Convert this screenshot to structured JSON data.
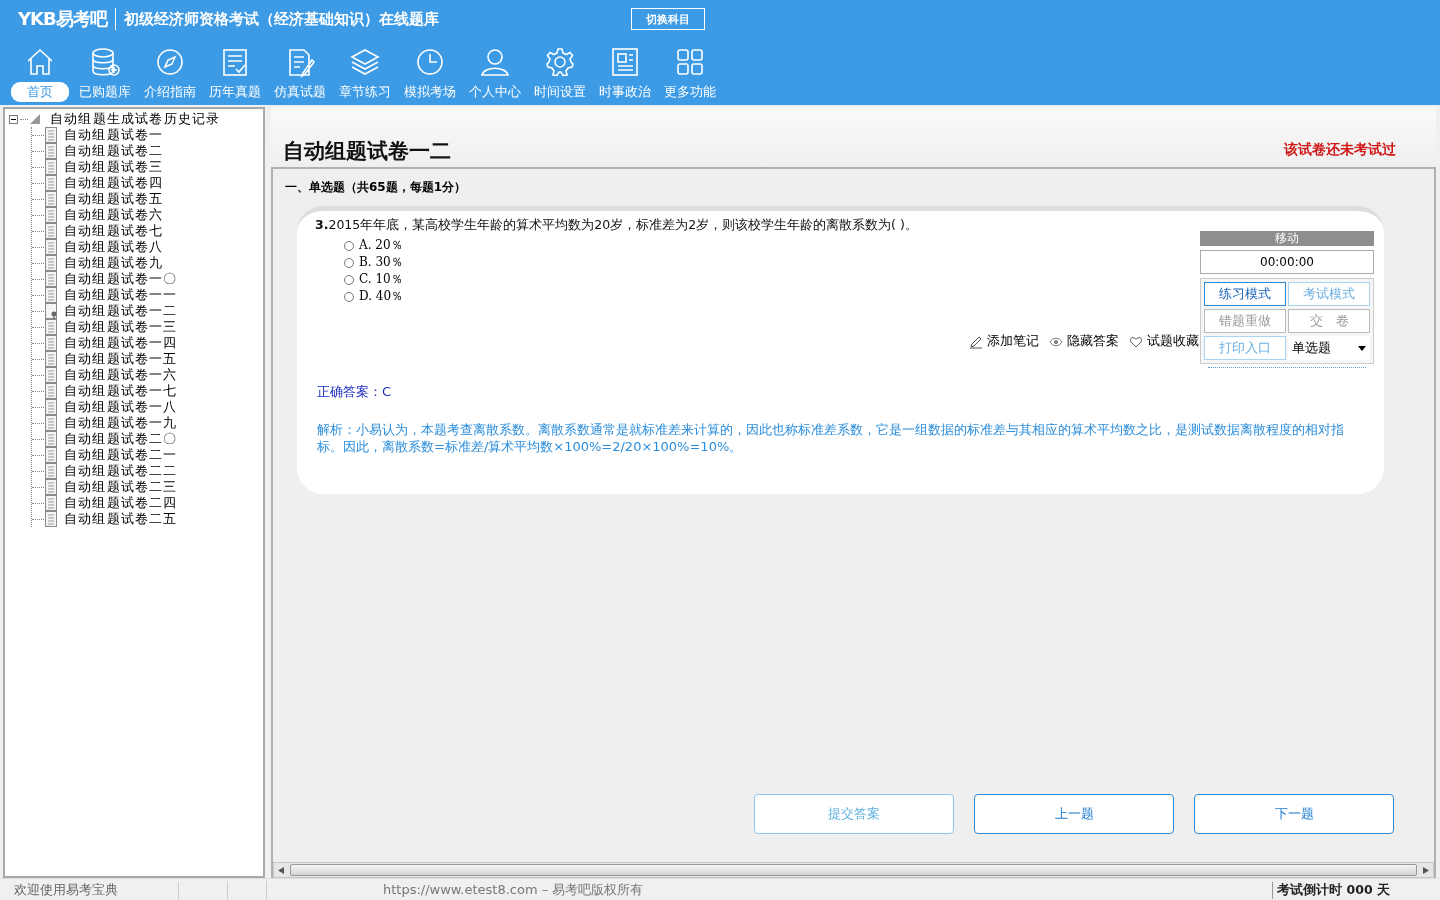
{
  "header": {
    "logo": "YKB易考吧",
    "title": "初级经济师资格考试（经济基础知识）在线题库",
    "switch_button": "切换科目"
  },
  "nav": {
    "items": [
      {
        "label": "首页",
        "selected": true
      },
      {
        "label": "已购题库",
        "selected": false
      },
      {
        "label": "介绍指南",
        "selected": false
      },
      {
        "label": "历年真题",
        "selected": false
      },
      {
        "label": "仿真试题",
        "selected": false
      },
      {
        "label": "章节练习",
        "selected": false
      },
      {
        "label": "模拟考场",
        "selected": false
      },
      {
        "label": "个人中心",
        "selected": false
      },
      {
        "label": "时间设置",
        "selected": false
      },
      {
        "label": "时事政治",
        "selected": false
      },
      {
        "label": "更多功能",
        "selected": false
      }
    ]
  },
  "tree": {
    "label": "自动组题生成试卷历史记录",
    "expanded": true,
    "children": [
      {
        "label": "自动组题试卷一",
        "current": false
      },
      {
        "label": "自动组题试卷二",
        "current": false
      },
      {
        "label": "自动组题试卷三",
        "current": false
      },
      {
        "label": "自动组题试卷四",
        "current": false
      },
      {
        "label": "自动组题试卷五",
        "current": false
      },
      {
        "label": "自动组题试卷六",
        "current": false
      },
      {
        "label": "自动组题试卷七",
        "current": false
      },
      {
        "label": "自动组题试卷八",
        "current": false
      },
      {
        "label": "自动组题试卷九",
        "current": false
      },
      {
        "label": "自动组题试卷一〇",
        "current": false
      },
      {
        "label": "自动组题试卷一一",
        "current": false
      },
      {
        "label": "自动组题试卷一二",
        "current": true
      },
      {
        "label": "自动组题试卷一三",
        "current": false
      },
      {
        "label": "自动组题试卷一四",
        "current": false
      },
      {
        "label": "自动组题试卷一五",
        "current": false
      },
      {
        "label": "自动组题试卷一六",
        "current": false
      },
      {
        "label": "自动组题试卷一七",
        "current": false
      },
      {
        "label": "自动组题试卷一八",
        "current": false
      },
      {
        "label": "自动组题试卷一九",
        "current": false
      },
      {
        "label": "自动组题试卷二〇",
        "current": false
      },
      {
        "label": "自动组题试卷二一",
        "current": false
      },
      {
        "label": "自动组题试卷二二",
        "current": false
      },
      {
        "label": "自动组题试卷二三",
        "current": false
      },
      {
        "label": "自动组题试卷二四",
        "current": false
      },
      {
        "label": "自动组题试卷二五",
        "current": false
      }
    ]
  },
  "exam": {
    "title": "自动组题试卷一二",
    "notice": "该试卷还未考试过",
    "section": "一、单选题（共65题，每题1分）",
    "question": {
      "number": "3.",
      "text": "2015年年底，某高校学生年龄的算术平均数为20岁，标准差为2岁，则该校学生年龄的离散系数为( )。",
      "options": [
        {
          "label": "A. 20％",
          "selected": false
        },
        {
          "label": "B. 30％",
          "selected": false
        },
        {
          "label": "C. 10％",
          "selected": false
        },
        {
          "label": "D. 40％",
          "selected": false
        }
      ],
      "actions": [
        {
          "label": "添加笔记"
        },
        {
          "label": "隐藏答案"
        },
        {
          "label": "试题收藏"
        }
      ],
      "answer": "正确答案：C",
      "analysis": "解析：小易认为，本题考查离散系数。离散系数通常是就标准差来计算的，因此也称标准差系数，它是一组数据的标准差与其相应的算术平均数之比，是测试数据离散程度的相对指标。因此，离散系数=标准差/算术平均数×100%=2/20×100%=10%。"
    },
    "control": {
      "handle": "移动",
      "timer": "00:00:00",
      "buttons": [
        {
          "label": "练习模式",
          "selected": true,
          "disabled": false
        },
        {
          "label": "考试模式",
          "selected": false,
          "disabled": false
        },
        {
          "label": "错题重做",
          "selected": false,
          "disabled": true
        },
        {
          "label": "交　卷",
          "selected": false,
          "disabled": true
        },
        {
          "label": "打印入口",
          "selected": false,
          "disabled": false
        }
      ],
      "type_select": "单选题"
    },
    "bottom_buttons": [
      {
        "label": "提交答案",
        "disabled": true
      },
      {
        "label": "上一题",
        "disabled": false
      },
      {
        "label": "下一题",
        "disabled": false
      }
    ]
  },
  "status_bar": {
    "welcome": "欢迎使用易考宝典",
    "copyright": "https://www.etest8.com – 易考吧版权所有",
    "countdown": "考试倒计时 000 天"
  }
}
